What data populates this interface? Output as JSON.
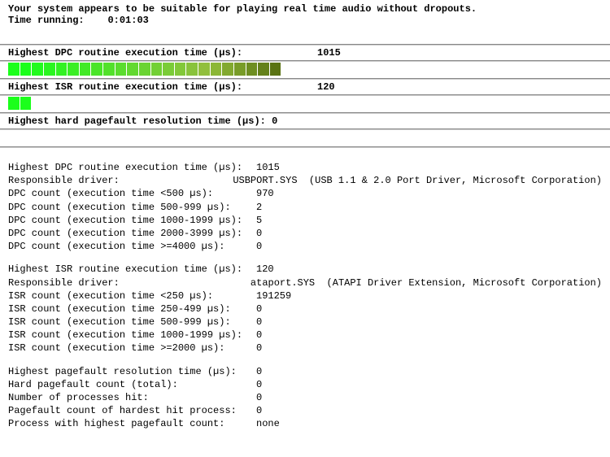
{
  "status": {
    "message": "Your system appears to be suitable for playing real time audio without dropouts.",
    "time_running_label": "Time running:",
    "time_running_value": "0:01:03"
  },
  "bars": {
    "dpc": {
      "label": "Highest DPC routine execution time (µs):",
      "value": "1015",
      "filled": 23,
      "total": 50,
      "colors": [
        "#1bff1b",
        "#1bff1b",
        "#22fb1e",
        "#2af620",
        "#32f222",
        "#3aee25",
        "#42ea27",
        "#4ae529",
        "#52e12b",
        "#5add2e",
        "#62d930",
        "#6ad432",
        "#72d034",
        "#7acc37",
        "#82c839",
        "#89c33b",
        "#91bf3d",
        "#8cb736",
        "#82a92f",
        "#789c28",
        "#6e8e21",
        "#64811a",
        "#5a7313"
      ]
    },
    "isr": {
      "label": "Highest ISR routine execution time (µs):",
      "value": "120",
      "filled": 2,
      "total": 50,
      "colors": [
        "#1bff1b",
        "#1bff1b"
      ]
    },
    "pagefault": {
      "label": "Highest hard pagefault resolution time (µs):",
      "value": "0",
      "filled": 0,
      "total": 50,
      "colors": []
    }
  },
  "details": {
    "dpc_block": [
      {
        "label": "Highest DPC routine execution time (µs):",
        "value": "1015"
      },
      {
        "label": "Responsible driver:",
        "value": "USBPORT.SYS  (USB 1.1 & 2.0 Port Driver, Microsoft Corporation)"
      },
      {
        "label": "DPC count (execution time <500 µs):",
        "value": "970"
      },
      {
        "label": "DPC count (execution time 500-999 µs):",
        "value": "2"
      },
      {
        "label": "DPC count (execution time 1000-1999 µs):",
        "value": "5"
      },
      {
        "label": "DPC count (execution time 2000-3999 µs):",
        "value": "0"
      },
      {
        "label": "DPC count (execution time >=4000 µs):",
        "value": "0"
      }
    ],
    "isr_block": [
      {
        "label": "Highest ISR routine execution time (µs):",
        "value": "120"
      },
      {
        "label": "Responsible driver:",
        "value": "ataport.SYS  (ATAPI Driver Extension, Microsoft Corporation)"
      },
      {
        "label": "ISR count (execution time <250 µs):",
        "value": "191259"
      },
      {
        "label": "ISR count (execution time 250-499 µs):",
        "value": "0"
      },
      {
        "label": "ISR count (execution time 500-999 µs):",
        "value": "0"
      },
      {
        "label": "ISR count (execution time 1000-1999 µs):",
        "value": "0"
      },
      {
        "label": "ISR count (execution time >=2000 µs):",
        "value": "0"
      }
    ],
    "pf_block": [
      {
        "label": "Highest pagefault resolution time (µs):",
        "value": "0"
      },
      {
        "label": "Hard pagefault count (total):",
        "value": "0"
      },
      {
        "label": "Number of processes hit:",
        "value": "0"
      },
      {
        "label": "Pagefault count of hardest hit process:",
        "value": "0"
      },
      {
        "label": "Process with highest pagefault count:",
        "value": "none"
      }
    ]
  }
}
